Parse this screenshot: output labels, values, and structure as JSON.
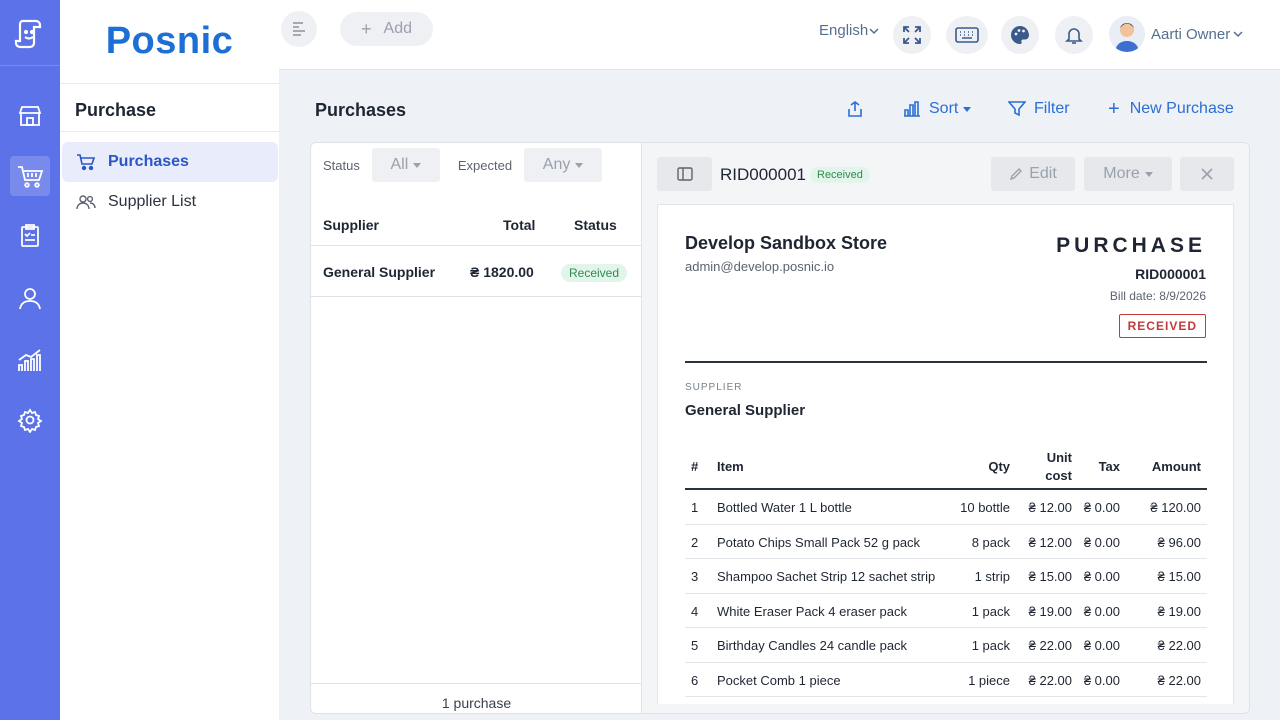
{
  "brand": "Posnic",
  "sidebar": {
    "section": "Purchase",
    "items": [
      {
        "label": "Purchases",
        "active": true
      },
      {
        "label": "Supplier List",
        "active": false
      }
    ]
  },
  "topbar": {
    "add_label": "Add",
    "language": "English",
    "user_name": "Aarti Owner"
  },
  "page": {
    "title": "Purchases",
    "actions": {
      "sort": "Sort",
      "filter": "Filter",
      "new": "New Purchase"
    }
  },
  "list": {
    "filters": {
      "status_label": "Status",
      "status_value": "All",
      "expected_label": "Expected",
      "expected_value": "Any"
    },
    "columns": {
      "supplier": "Supplier",
      "total": "Total",
      "status": "Status"
    },
    "rows": [
      {
        "supplier": "General Supplier",
        "total": "₴ 1820.00",
        "status": "Received"
      }
    ],
    "footer": "1 purchase"
  },
  "detail": {
    "rid": "RID000001",
    "status_badge": "Received",
    "edit_label": "Edit",
    "more_label": "More",
    "doc": {
      "store_name": "Develop Sandbox Store",
      "store_email": "admin@develop.posnic.io",
      "kind": "PURCHASE",
      "rid": "RID000001",
      "bill_date": "Bill date: 8/9/2026",
      "status": "RECEIVED",
      "supplier_label": "SUPPLIER",
      "supplier_name": "General Supplier",
      "columns": {
        "idx": "#",
        "item": "Item",
        "qty": "Qty",
        "unit_cost_1": "Unit",
        "unit_cost_2": "cost",
        "tax": "Tax",
        "amount": "Amount"
      },
      "items": [
        {
          "idx": "1",
          "item": "Bottled Water 1 L bottle",
          "qty": "10 bottle",
          "unit": "₴ 12.00",
          "tax": "₴ 0.00",
          "amount": "₴ 120.00"
        },
        {
          "idx": "2",
          "item": "Potato Chips Small Pack 52 g pack",
          "qty": "8 pack",
          "unit": "₴ 12.00",
          "tax": "₴ 0.00",
          "amount": "₴ 96.00"
        },
        {
          "idx": "3",
          "item": "Shampoo Sachet Strip 12 sachet strip",
          "qty": "1 strip",
          "unit": "₴ 15.00",
          "tax": "₴ 0.00",
          "amount": "₴ 15.00"
        },
        {
          "idx": "4",
          "item": "White Eraser Pack 4 eraser pack",
          "qty": "1 pack",
          "unit": "₴ 19.00",
          "tax": "₴ 0.00",
          "amount": "₴ 19.00"
        },
        {
          "idx": "5",
          "item": "Birthday Candles 24 candle pack",
          "qty": "1 pack",
          "unit": "₴ 22.00",
          "tax": "₴ 0.00",
          "amount": "₴ 22.00"
        },
        {
          "idx": "6",
          "item": "Pocket Comb 1 piece",
          "qty": "1 piece",
          "unit": "₴ 22.00",
          "tax": "₴ 0.00",
          "amount": "₴ 22.00"
        }
      ]
    }
  },
  "colors": {
    "rail": "#5b72e8",
    "brand": "#1d6fd6",
    "accent": "#2a6fd6",
    "received": "#2f8a52",
    "status_red": "#c23a3a"
  }
}
